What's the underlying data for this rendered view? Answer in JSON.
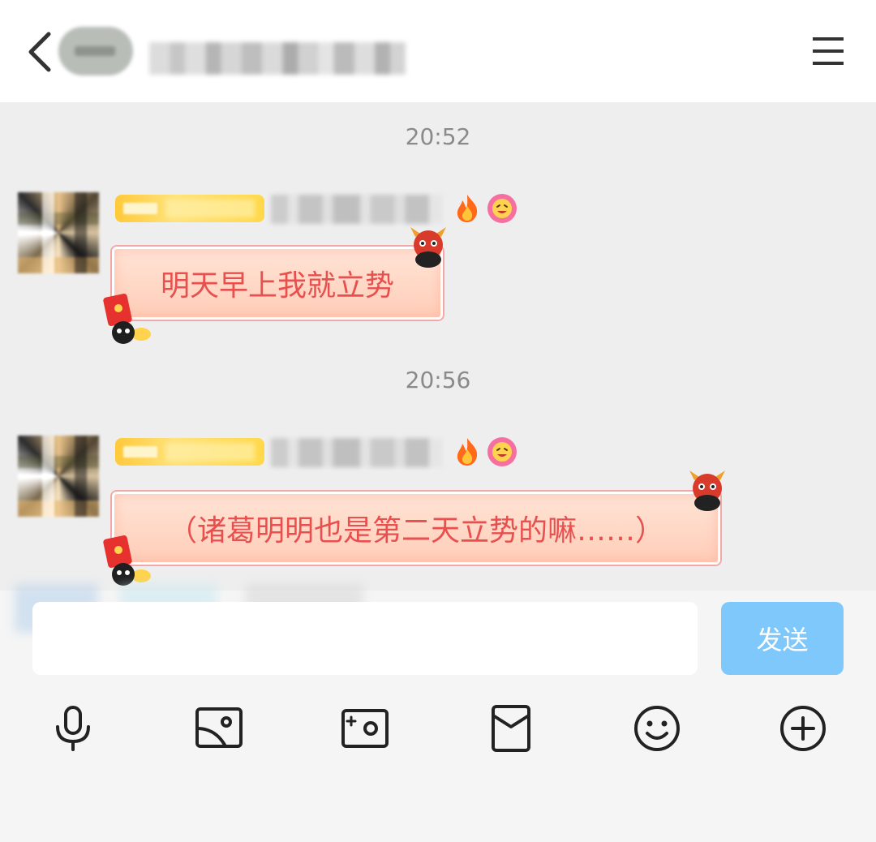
{
  "header": {
    "title": "",
    "back_icon": "chevron-left-icon",
    "menu_icon": "hamburger-menu-icon"
  },
  "messages": [
    {
      "time": "20:52",
      "text": "明天早上我就立势",
      "icons": [
        "fire-icon",
        "flower-face-icon",
        "dragon-sticker-icon",
        "red-envelope-icon"
      ]
    },
    {
      "time": "20:56",
      "text": "（诸葛明明也是第二天立势的嘛……）",
      "icons": [
        "fire-icon",
        "flower-face-icon",
        "dragon-sticker-icon",
        "red-envelope-icon"
      ]
    }
  ],
  "input": {
    "value": "",
    "placeholder": "",
    "send_label": "发送"
  },
  "toolbar": {
    "items": [
      "microphone-icon",
      "image-icon",
      "camera-icon",
      "red-packet-icon",
      "emoji-icon",
      "plus-icon"
    ]
  },
  "colors": {
    "accent": "#7fc8fb",
    "bubble_text": "#e8504f",
    "chat_background": "#eeeeee",
    "badge_gold": "#ffc93a"
  }
}
